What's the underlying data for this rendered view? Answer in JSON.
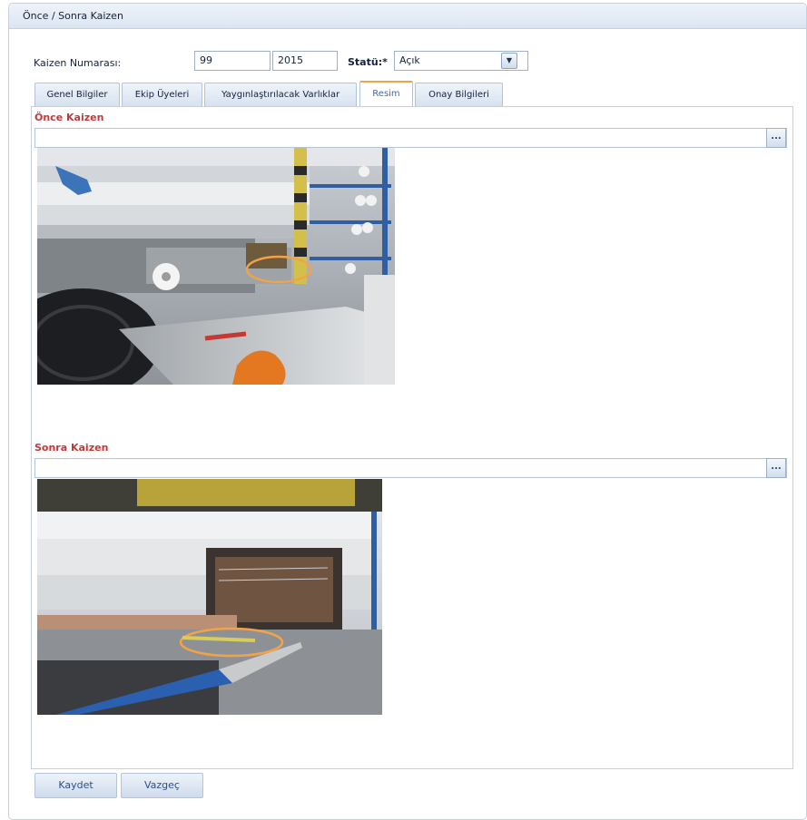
{
  "window": {
    "title": "Önce / Sonra Kaizen"
  },
  "form": {
    "kaizen_label": "Kaizen Numarası:",
    "kaizen_number": "99",
    "kaizen_year": "2015",
    "status_label": "Statü:*",
    "status_value": "Açık"
  },
  "tabs": [
    {
      "label": "Genel Bilgiler"
    },
    {
      "label": "Ekip Üyeleri"
    },
    {
      "label": "Yaygınlaştırılacak Varlıklar"
    },
    {
      "label": "Resim",
      "active": true
    },
    {
      "label": "Onay Bilgileri"
    }
  ],
  "before": {
    "label": "Önce Kaizen",
    "browse": "..."
  },
  "after": {
    "label": "Sonra Kaizen",
    "browse": "..."
  },
  "buttons": {
    "save": "Kaydet",
    "cancel": "Vazgeç"
  },
  "icons": {
    "dropdown": "chevron-down-icon",
    "browse": "ellipsis-icon"
  },
  "colors": {
    "section_label": "#c03a3a",
    "active_tab_accent": "#f2a347",
    "highlight_circle": "#f2a347"
  }
}
